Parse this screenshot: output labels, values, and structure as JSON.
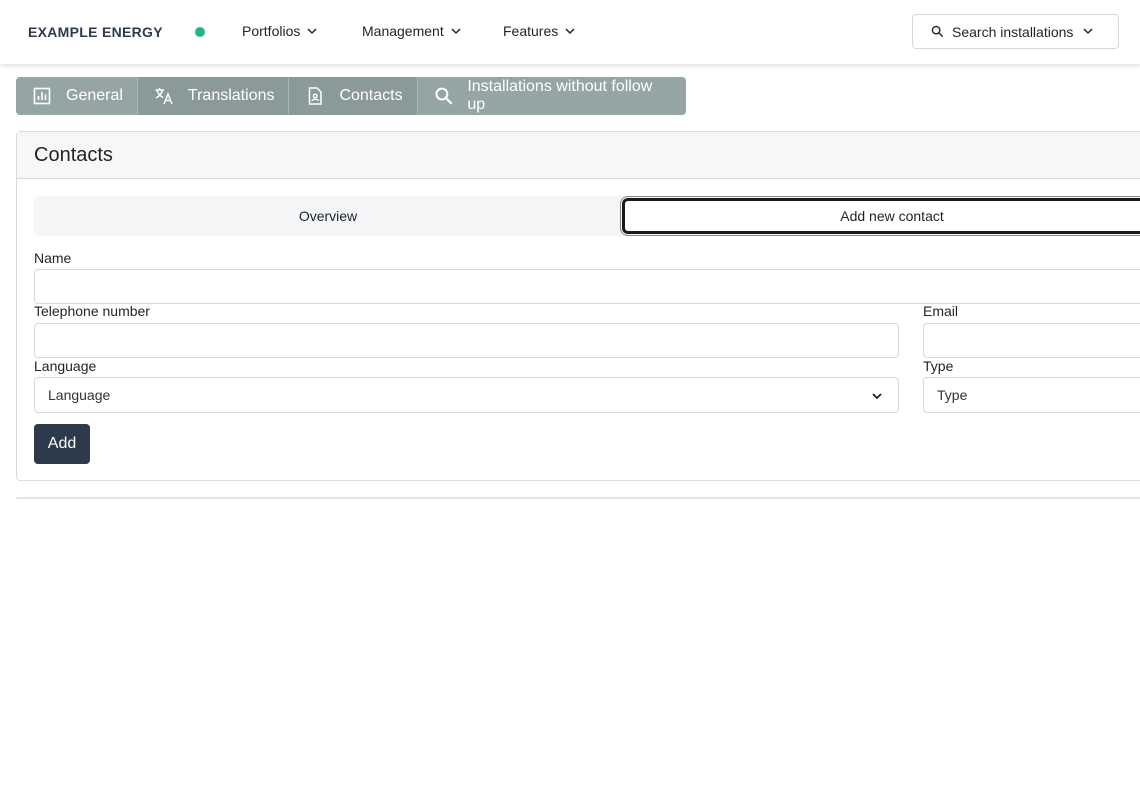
{
  "navbar": {
    "brand": "EXAMPLE ENERGY",
    "status_color": "#1fba7a",
    "menus": [
      {
        "label": "Portfolios"
      },
      {
        "label": "Management"
      },
      {
        "label": "Features"
      }
    ],
    "search_label": "Search installations"
  },
  "tabs": [
    {
      "label": "General",
      "icon": "chart-icon"
    },
    {
      "label": "Translations",
      "icon": "translate-icon"
    },
    {
      "label": "Contacts",
      "icon": "contact-document-icon"
    },
    {
      "label": "Installations without follow up",
      "icon": "search-icon"
    }
  ],
  "card": {
    "title": "Contacts",
    "segments": {
      "overview": "Overview",
      "add_new": "Add new contact",
      "selected": "Add new contact"
    },
    "form": {
      "name_label": "Name",
      "name_value": "",
      "telephone_label": "Telephone number",
      "telephone_value": "",
      "email_label": "Email",
      "email_value": "",
      "language_label": "Language",
      "language_selected": "Language",
      "type_label": "Type",
      "type_selected": "Type",
      "submit_label": "Add"
    }
  },
  "colors": {
    "tabbar": "#95a5a6",
    "primary_button": "#2c3a4b"
  }
}
